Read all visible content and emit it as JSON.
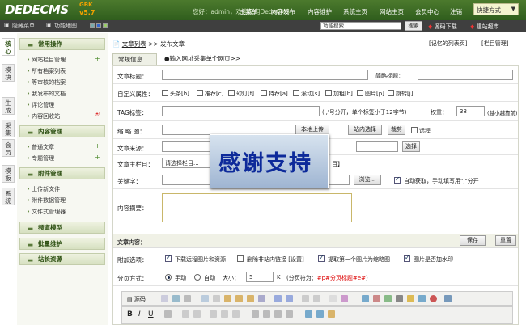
{
  "header": {
    "logo": "DEDECMS",
    "version_badge": "GBK",
    "version": "v5.7",
    "welcome": "您好：admin，欢迎使用DedeCMS！",
    "nav": [
      "主菜单",
      "内容发布",
      "内容维护",
      "系统主页",
      "网站主页",
      "会员中心",
      "注销"
    ],
    "quick": "快捷方式"
  },
  "subbar": {
    "hide_menu": "隐藏菜单",
    "sitemap": "功能地图",
    "search_value": "功能搜索",
    "search_btn": "搜索",
    "source_download": "源码下载",
    "build_site": "建站超市"
  },
  "vtabs": [
    "核心",
    "模块",
    "生成",
    "采集",
    "会员",
    "模板",
    "系统"
  ],
  "sidebar": {
    "groups": [
      {
        "title": "常用操作",
        "items": [
          "网站栏目管理",
          "所有档案列表",
          "等审核的档案",
          "我发布的文档",
          "评论管理",
          "内容回收站"
        ]
      },
      {
        "title": "内容管理",
        "items": [
          "普通文章",
          "专题管理"
        ]
      },
      {
        "title": "附件管理",
        "items": [
          "上传新文件",
          "附件数据管理",
          "文件式管理器"
        ]
      },
      {
        "title": "频道模型",
        "items": []
      },
      {
        "title": "批量维护",
        "items": []
      },
      {
        "title": "站长资源",
        "items": []
      }
    ]
  },
  "main": {
    "breadcrumb_link": "文章列表",
    "breadcrumb_sep": ">>",
    "breadcrumb_current": "发布文章",
    "remember_link": "[记忆的列表页]",
    "column_link": "[栏目管理]",
    "tab_info": "常规信息",
    "tab_collect": "●输入网址采集单个网页>>",
    "title_label": "文章标题：",
    "short_title_label": "简略标题：",
    "custom_attr_label": "自定义属性：",
    "attrs": [
      "头条[h]",
      "推荐[c]",
      "幻灯[f]",
      "特荐[a]",
      "滚动[s]",
      "加粗[b]",
      "图片[p]",
      "跳转[j]"
    ],
    "tag_label": "TAG标签：",
    "tag_hint": "(','号分开，单个标签小于12字节)",
    "weight_label": "权重：",
    "weight_value": "38",
    "weight_hint": "(越小越靠前)",
    "thumb_label": "缩 略 图：",
    "local_upload": "本地上传",
    "site_select": "站内选择",
    "crop": "裁剪",
    "remote": "远程",
    "source_label": "文章来源：",
    "author_label": "作　者：",
    "select_btn": "选择",
    "column_label": "文章主栏目：",
    "column_select": "请选择栏目...",
    "column_right": "目】",
    "keyword_label": "关键字：",
    "browse": "浏览...",
    "auto_fetch": "自动获取，手动填写用\",\"分开",
    "summary_label": "内容摘要：",
    "content_label": "文章内容：",
    "save": "保存",
    "reset": "重置",
    "attach_label": "附加选项：",
    "opt_download": "下载远程图片和资源",
    "opt_remove_links": "删除非站内链接 [设置]",
    "opt_first_image": "提取第一个图片为缩略图",
    "opt_watermark": "图片是否加水印",
    "paging_label": "分页方式：",
    "paging_manual": "手动",
    "paging_auto": "自动",
    "paging_size": "大小：",
    "paging_value": "5",
    "paging_unit": "K",
    "paging_hint": "(分页符为：",
    "paging_sep": "#p#分页标题#e#",
    "paging_close": ")",
    "editor_source": "源码"
  },
  "overlay": {
    "text": "感谢支持"
  }
}
